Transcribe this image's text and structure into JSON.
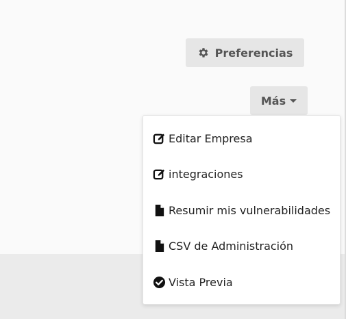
{
  "toolbar": {
    "preferences_label": "Preferencias",
    "more_label": "Más"
  },
  "menu": {
    "items": [
      {
        "label": "Editar Empresa",
        "icon": "edit-icon"
      },
      {
        "label": "integraciones",
        "icon": "edit-icon"
      },
      {
        "label": "Resumir mis vulnerabilidades",
        "icon": "file-icon"
      },
      {
        "label": "CSV de Administración",
        "icon": "file-icon"
      },
      {
        "label": "Vista Previa",
        "icon": "check-circle-icon"
      }
    ]
  },
  "colors": {
    "button_bg": "#e6e6e6",
    "button_text": "#555555",
    "menu_text": "#222222",
    "icon": "#111111",
    "page_bg_top": "#fafafa",
    "page_bg_bottom": "#ebebeb"
  }
}
